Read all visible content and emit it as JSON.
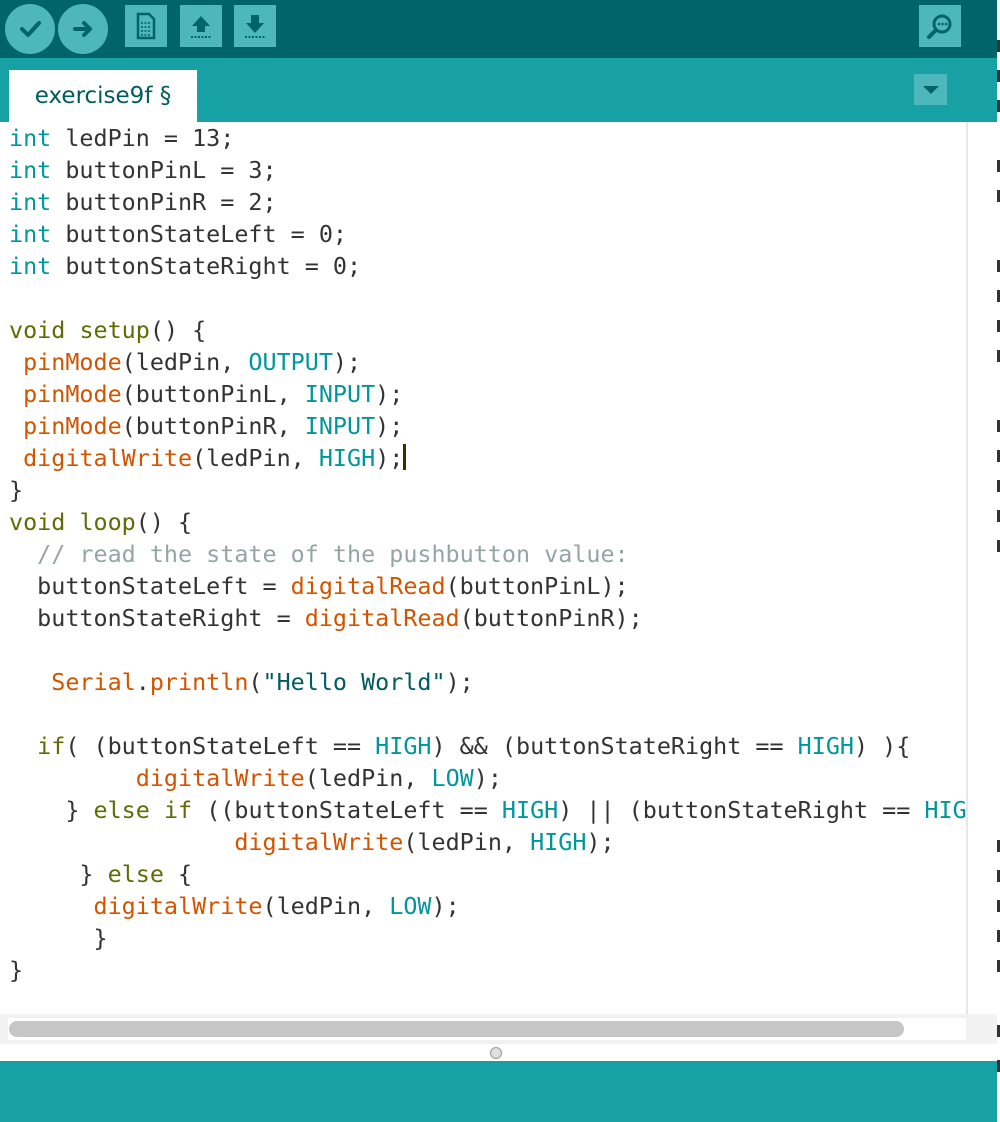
{
  "toolbar": {
    "buttons": [
      "verify-icon",
      "upload-icon",
      "new-icon",
      "open-icon",
      "save-icon",
      "serial-monitor-icon"
    ],
    "colors": {
      "bar": "#006468",
      "button": "#4db7bb"
    }
  },
  "tabs": [
    {
      "label": "exercise9f §"
    }
  ],
  "editor": {
    "colors": {
      "keyword": "#00979c",
      "structure": "#5e6d03",
      "function": "#d35400",
      "comment": "#95a5a6",
      "string": "#005c5f"
    },
    "lines": [
      "int ledPin = 13;",
      "int buttonPinL = 3;",
      "int buttonPinR = 2;",
      "int buttonStateLeft = 0;",
      "int buttonStateRight = 0;",
      "",
      "void setup() {",
      " pinMode(ledPin, OUTPUT);",
      " pinMode(buttonPinL, INPUT);",
      " pinMode(buttonPinR, INPUT);",
      " digitalWrite(ledPin, HIGH);",
      "}",
      "void loop() {",
      "  // read the state of the pushbutton value:",
      "  buttonStateLeft = digitalRead(buttonPinL);",
      "  buttonStateRight = digitalRead(buttonPinR);",
      "",
      "   Serial.println(\"Hello World\");",
      "",
      "  if( (buttonStateLeft == HIGH) && (buttonStateRight == HIGH) ){",
      "         digitalWrite(ledPin, LOW);",
      "    } else if ((buttonStateLeft == HIGH) || (buttonStateRight == HIGH",
      "                digitalWrite(ledPin, HIGH);",
      "     } else {",
      "      digitalWrite(ledPin, LOW);",
      "      }",
      "}"
    ]
  },
  "statusbar": {
    "color": "#17a1a5"
  }
}
